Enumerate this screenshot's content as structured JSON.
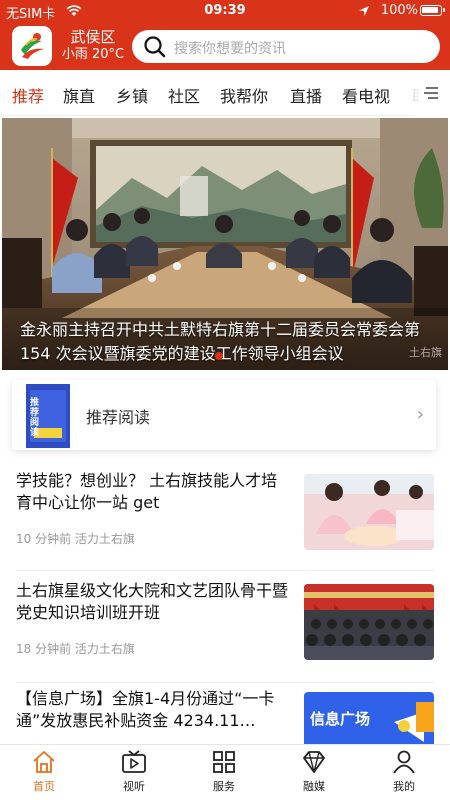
{
  "status_bar": {
    "carrier": "无SIM卡",
    "time": "09:39",
    "battery": "100%"
  },
  "header": {
    "location": "武侯区",
    "weather": "小雨 20°C",
    "search_placeholder": "搜索你想要的资讯"
  },
  "tabs": [
    {
      "label": "推荐",
      "active": true
    },
    {
      "label": "旗直"
    },
    {
      "label": "乡镇"
    },
    {
      "label": "社区"
    },
    {
      "label": "我帮你"
    },
    {
      "label": "直播"
    },
    {
      "label": "看电视"
    },
    {
      "label": "职"
    }
  ],
  "banner": {
    "caption": "金永丽主持召开中共土默特右旗第十二届委员会常委会第 154 次会议暨旗委党的建设工作领导小组会议",
    "watermark": "土右旗"
  },
  "recommended": {
    "label": "推荐阅读",
    "thumb_text": "推荐阅读"
  },
  "articles": [
    {
      "title": "学技能？想创业？ 土右旗技能人才培育中心让你一站 get",
      "time": "10 分钟前",
      "source": "活力土右旗"
    },
    {
      "title": "土右旗星级文化大院和文艺团队骨干暨党史知识培训班开班",
      "time": "18 分钟前",
      "source": "活力土右旗"
    },
    {
      "title": "【信息广场】全旗1-4月份通过“一卡通”发放惠民补贴资金 4234.11…",
      "image_text": "信息广场"
    }
  ],
  "bottom_nav": [
    {
      "label": "首页",
      "active": true
    },
    {
      "label": "视听"
    },
    {
      "label": "服务"
    },
    {
      "label": "融媒"
    },
    {
      "label": "我的"
    }
  ],
  "colors": {
    "accent": "#d9331a",
    "nav_active": "#e8701a"
  }
}
